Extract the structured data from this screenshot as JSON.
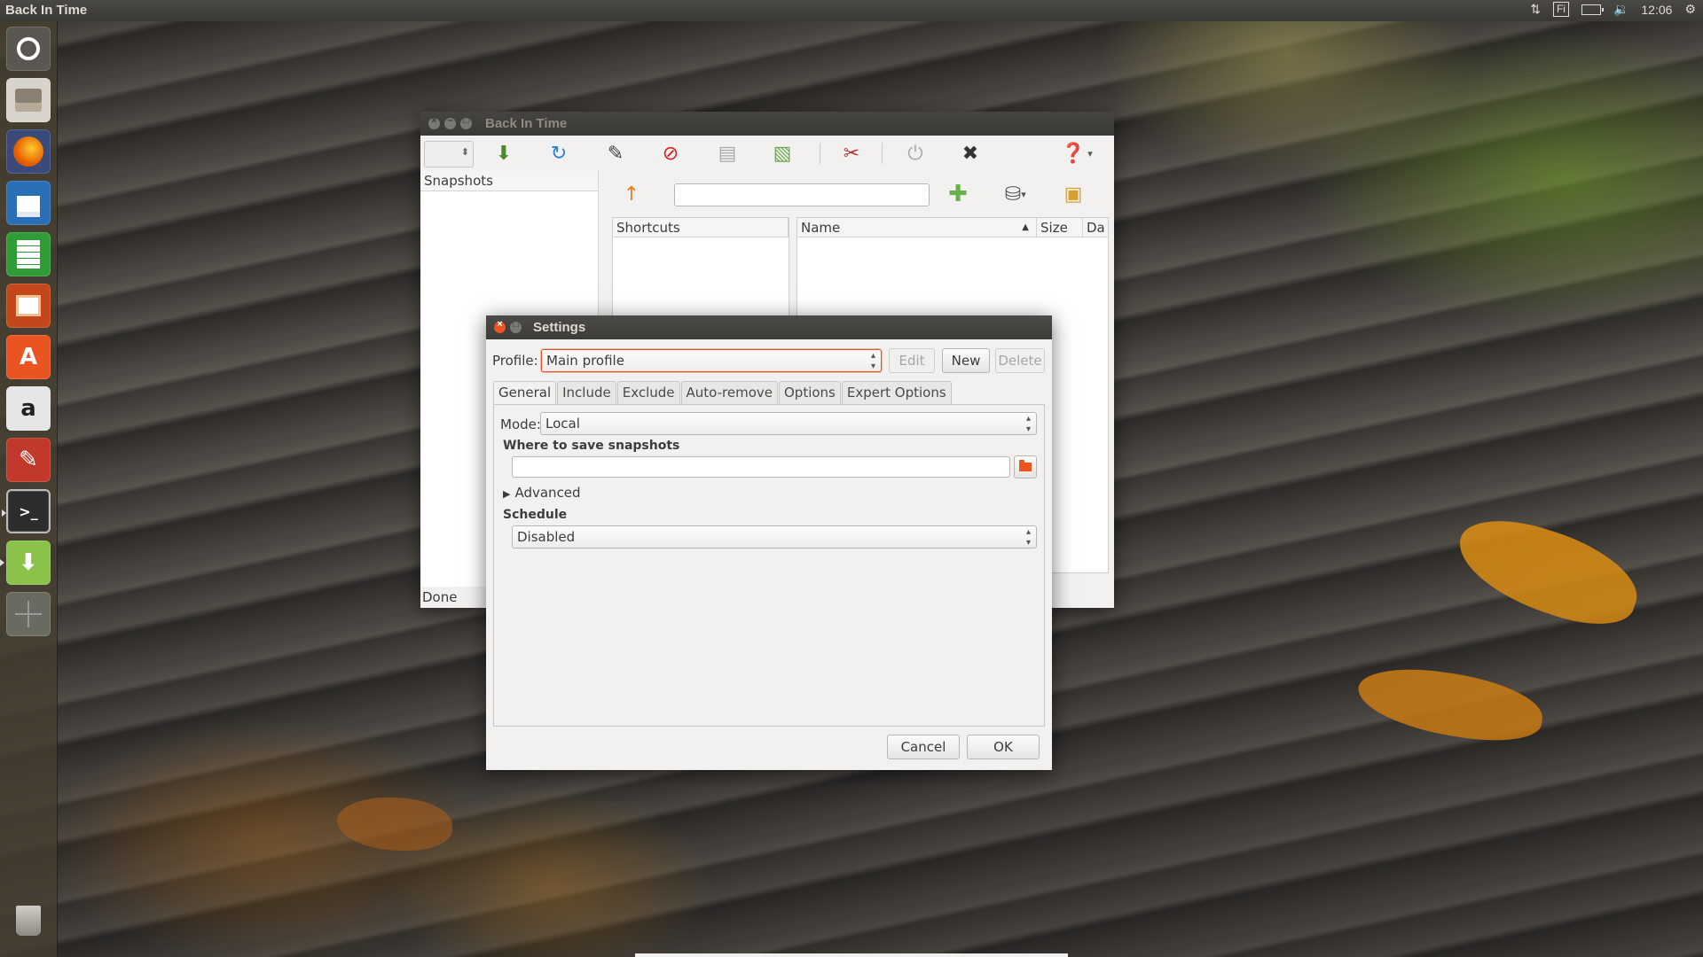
{
  "top_panel": {
    "app_title": "Back In Time",
    "keyboard_layout": "Fi",
    "clock": "12:06"
  },
  "launcher": {
    "items": [
      {
        "name": "dash-home",
        "icon": "ubuntu-logo-icon",
        "color": "#5a5650"
      },
      {
        "name": "files",
        "icon": "file-cabinet-icon",
        "color": "#d9d4cb"
      },
      {
        "name": "firefox",
        "icon": "firefox-icon",
        "color": "#e66000"
      },
      {
        "name": "libreoffice-writer",
        "icon": "writer-icon",
        "color": "#2a6fb5"
      },
      {
        "name": "libreoffice-calc",
        "icon": "calc-icon",
        "color": "#2f9c38"
      },
      {
        "name": "libreoffice-impress",
        "icon": "impress-icon",
        "color": "#c4461b"
      },
      {
        "name": "software-center",
        "icon": "software-center-icon",
        "color": "#e95420"
      },
      {
        "name": "amazon",
        "icon": "amazon-icon",
        "color": "#e6e6e6"
      },
      {
        "name": "system-settings",
        "icon": "settings-tools-icon",
        "color": "#c0392b"
      },
      {
        "name": "terminal",
        "icon": "terminal-icon",
        "color": "#2c2c2c"
      },
      {
        "name": "back-in-time",
        "icon": "download-tray-icon",
        "color": "#8bc34a"
      },
      {
        "name": "workspace-switcher",
        "icon": "workspaces-icon",
        "color": "#6a6a60"
      },
      {
        "name": "trash",
        "icon": "trash-icon",
        "color": "#8a8a82"
      }
    ]
  },
  "main_window": {
    "title": "Back In Time",
    "snapshots_header": "Snapshots",
    "shortcuts_header": "Shortcuts",
    "columns": [
      "Name",
      "Size",
      "Da"
    ],
    "status": "Done",
    "toolbar_icons": [
      "take-snapshot-icon",
      "refresh-icon",
      "edit-name-icon",
      "remove-snapshot-icon",
      "view-log-icon",
      "view-last-log-icon",
      "settings-icon",
      "shutdown-icon",
      "exit-icon",
      "help-icon"
    ],
    "path_value": ""
  },
  "settings": {
    "title": "Settings",
    "profile_label": "Profile:",
    "profile_value": "Main profile",
    "edit_label": "Edit",
    "new_label": "New",
    "delete_label": "Delete",
    "tabs": [
      "General",
      "Include",
      "Exclude",
      "Auto-remove",
      "Options",
      "Expert Options"
    ],
    "active_tab": "General",
    "mode_label": "Mode:",
    "mode_value": "Local",
    "where_label": "Where to save snapshots",
    "where_value": "",
    "advanced_label": "Advanced",
    "schedule_label": "Schedule",
    "schedule_value": "Disabled",
    "cancel_label": "Cancel",
    "ok_label": "OK"
  },
  "colors": {
    "accent": "#e95420",
    "panel": "#3c3b37",
    "window_bg": "#f2f1f0"
  }
}
